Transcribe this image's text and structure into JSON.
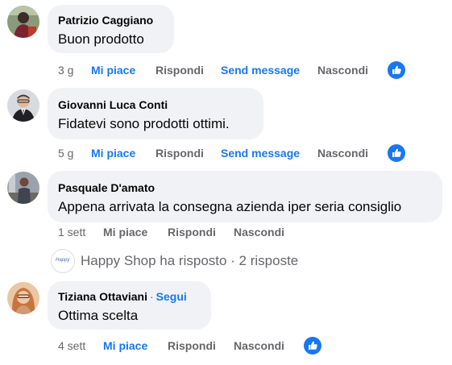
{
  "colors": {
    "accent": "#1877f2",
    "bubble": "#f0f2f5",
    "muted": "#65676b"
  },
  "comments": [
    {
      "author": "Patrizio Caggiano",
      "text": "Buon prodotto",
      "time": "3 g",
      "like": "Mi piace",
      "reply": "Rispondi",
      "send": "Send message",
      "hide": "Nascondi",
      "reaction_icon": "thumbs-up-icon"
    },
    {
      "author": "Giovanni Luca Conti",
      "text": "Fidatevi sono prodotti ottimi.",
      "time": "5 g",
      "like": "Mi piace",
      "reply": "Rispondi",
      "send": "Send message",
      "hide": "Nascondi",
      "reaction_icon": "thumbs-up-icon"
    },
    {
      "author": "Pasquale D'amato",
      "text": "Appena arrivata la consegna azienda iper seria consiglio",
      "time": "1 sett",
      "like": "Mi piace",
      "reply": "Rispondi",
      "hide": "Nascondi"
    },
    {
      "author": "Tiziana Ottaviani",
      "separator": "·",
      "follow": "Segui",
      "text": "Ottima scelta",
      "time": "4 sett",
      "like": "Mi piace",
      "reply": "Rispondi",
      "hide": "Nascondi",
      "reaction_icon": "thumbs-up-icon"
    }
  ],
  "replies_summary": {
    "page_avatar_text": "Happy",
    "text": "Happy Shop ha risposto · 2 risposte"
  }
}
